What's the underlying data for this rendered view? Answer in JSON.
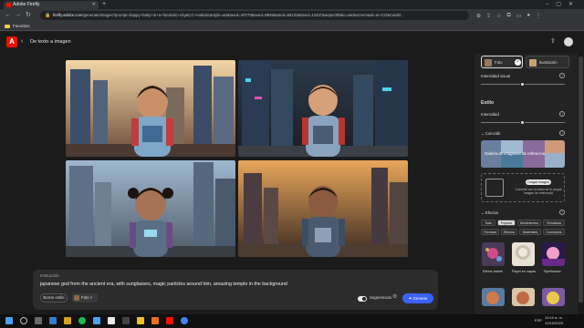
{
  "browser": {
    "tab_title": "Adobe Firefly",
    "url_host": "firefly.adobe.com",
    "url_path": "/generate/images?prompt=happy+baby+in+a+futuristic+city&CC+realistic&style=art&seed=40770&seed=9926&seed=56132&seed=13337&aspectRatio=widescreen&id=en-CO&model...",
    "bookmark": "Favoritos"
  },
  "app": {
    "back_label": "De texto a imagen",
    "logo_letter": "A"
  },
  "prompt": {
    "label": "Instrucción",
    "text": "japanese god from the ancient era, with sunglasses, magic particles around him, amazing temple in the background",
    "clear_style": "Borrar estilo",
    "photo_chip": "Foto",
    "suggestions": "Sugerencias",
    "generate": "Generar"
  },
  "panel": {
    "content_types": [
      "Foto",
      "Ilustración"
    ],
    "visual_intensity": "Intensidad visual",
    "style_heading": "Estilo",
    "intensity": "Intensidad",
    "match_heading": "Coincidir",
    "reference_gallery": "Galería de imágenes de referencia",
    "upload_button": "Cargar imagen",
    "upload_caption": "Coincide con el estilo de tu propia imagen de referencia",
    "effects_heading": "Efectos",
    "effect_tabs_row1": [
      "Todo",
      "Popular",
      "Movimientos",
      "Temáticas"
    ],
    "effect_tabs_row2": [
      "Técnicas",
      "Efectos",
      "Materiales",
      "Conceptos"
    ],
    "selected_tab": "Popular",
    "effect_items": [
      "Efecto bokeh",
      "Papel en capas",
      "Synthwave"
    ]
  },
  "taskbar": {
    "time": "10:10 a. m.",
    "date": "12/10/2023",
    "lang": "ESP"
  },
  "colors": {
    "accent": "#3b63fb",
    "adobe_red": "#eb1000"
  }
}
